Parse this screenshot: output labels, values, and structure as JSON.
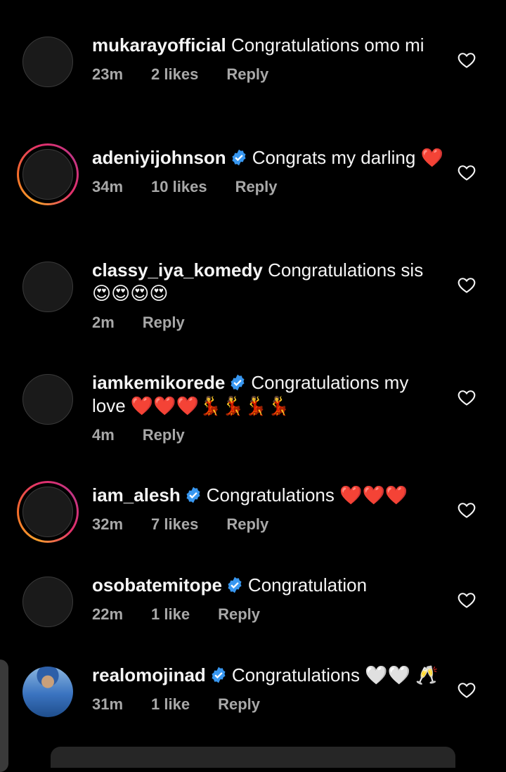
{
  "comments": [
    {
      "username": "mukarayofficial",
      "verified": false,
      "text": "Congratulations  omo mi",
      "time": "23m",
      "likes": "2 likes",
      "reply": "Reply",
      "ring": false
    },
    {
      "username": "adeniyijohnson",
      "verified": true,
      "text": "Congrats my darling ❤️",
      "time": "34m",
      "likes": "10 likes",
      "reply": "Reply",
      "ring": true
    },
    {
      "username": "classy_iya_komedy",
      "verified": false,
      "text": "Congratulations sis 😍😍😍😍",
      "time": "2m",
      "likes": "",
      "reply": "Reply",
      "ring": false
    },
    {
      "username": "iamkemikorede",
      "verified": true,
      "text": "Congratulations my love ❤️❤️❤️💃💃💃💃",
      "time": "4m",
      "likes": "",
      "reply": "Reply",
      "ring": false
    },
    {
      "username": "iam_alesh",
      "verified": true,
      "text": "Congratulations ❤️❤️❤️",
      "time": "32m",
      "likes": "7 likes",
      "reply": "Reply",
      "ring": true
    },
    {
      "username": "osobatemitope",
      "verified": true,
      "text": "Congratulation",
      "time": "22m",
      "likes": "1 like",
      "reply": "Reply",
      "ring": false
    },
    {
      "username": "realomojinad",
      "verified": true,
      "text": "Congratulations 🤍🤍 🥂",
      "time": "31m",
      "likes": "1 like",
      "reply": "Reply",
      "ring": false
    }
  ],
  "icons": {
    "like": "heart-outline-icon",
    "verified": "verified-badge-icon"
  },
  "colors": {
    "verified": "#3897f0",
    "meta": "#a8a8a8"
  }
}
